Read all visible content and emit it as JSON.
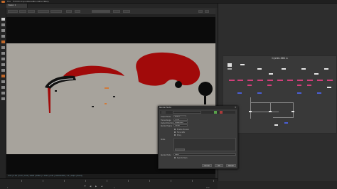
{
  "menubar": {
    "items": [
      "File",
      "Edit",
      "Workspace",
      "Viewer",
      "Render",
      "Cache",
      "Help"
    ],
    "item_x": [
      10,
      18,
      24,
      38,
      46,
      55,
      62
    ]
  },
  "tabs": {
    "items": [
      {
        "label": "Viewer 1",
        "active": true
      },
      {
        "label": "Node Graph",
        "active": false
      },
      {
        "label": "Curve Editor",
        "active": false
      },
      {
        "label": "Dope Sheet",
        "active": false
      },
      {
        "label": "Properties",
        "active": false
      },
      {
        "label": "Dope Sheet",
        "active": false
      }
    ]
  },
  "viewer": {
    "status_text": "0.00 | 0.00 | 0.00 | 0.00 | sRGB | RGBA | x 1024 y 540 | 1920x1080 | 1.0 | 24fps | Ready"
  },
  "timeline": {
    "start_label": "1",
    "end_label": "100",
    "current_frame": "1",
    "playback_labels": [
      "⏮",
      "◀",
      "▶",
      "⏭"
    ]
  },
  "node_graph": {
    "title": "Cycles 4D1 a"
  },
  "dialog": {
    "title": "Render Node",
    "close": "✕",
    "rows": [
      {
        "label": "Output Node",
        "value": "Write1"
      },
      {
        "label": "Frame Range",
        "value": "1-100"
      },
      {
        "label": "Output Directory",
        "value": "/render/out"
      },
      {
        "label": "Render Engine",
        "value": "Cycles"
      }
    ],
    "checkbox_labels": [
      "Enable Preview",
      "Force GPU",
      "Proxy"
    ],
    "notes_label": "Notes",
    "bottom_label": "Render Mode",
    "bottom_value": "Local",
    "checkbox_bottom": "Send to Farm",
    "buttons": {
      "cancel": "Cancel",
      "ok": "OK",
      "render": "Render"
    }
  },
  "colors": {
    "accent": "#c0682a",
    "node_pink": "#d23f7a",
    "node_blue": "#4a5fd6",
    "node_white": "#e6e6e6",
    "frame_bg": "#a7a39c",
    "shape_red": "#a10a0a"
  }
}
